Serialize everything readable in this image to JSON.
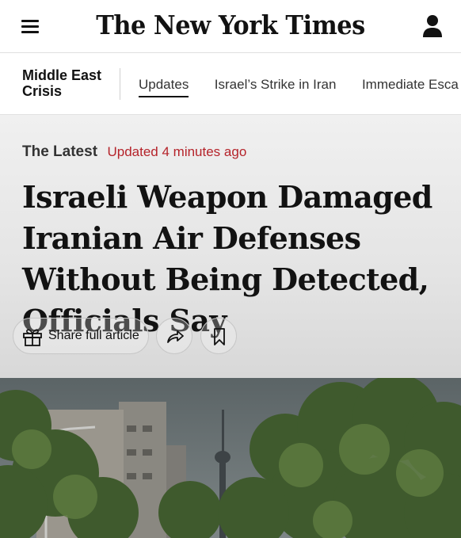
{
  "header": {
    "logo_text": "The New York Times",
    "menu_icon": "hamburger-menu-icon",
    "account_icon": "user-account-icon"
  },
  "section_nav": {
    "title": "Middle East Crisis",
    "links": [
      {
        "label": "Updates",
        "active": true
      },
      {
        "label": "Israel’s Strike in Iran",
        "active": false
      },
      {
        "label": "Immediate Esca",
        "active": false
      }
    ]
  },
  "article": {
    "kicker": "The Latest",
    "updated": "Updated 4 minutes ago",
    "headline": "Israeli Weapon Damaged Iranian Air Defenses Without Being Detected, Officials Say",
    "share_label": "Share full article",
    "share_icon": "gift-icon",
    "forward_icon": "share-arrow-icon",
    "save_icon": "bookmark-icon"
  },
  "colors": {
    "text": "#121212",
    "updated_red": "#b5232a",
    "hero_bg": "#e4e4e4",
    "border": "#dfdfdf"
  }
}
